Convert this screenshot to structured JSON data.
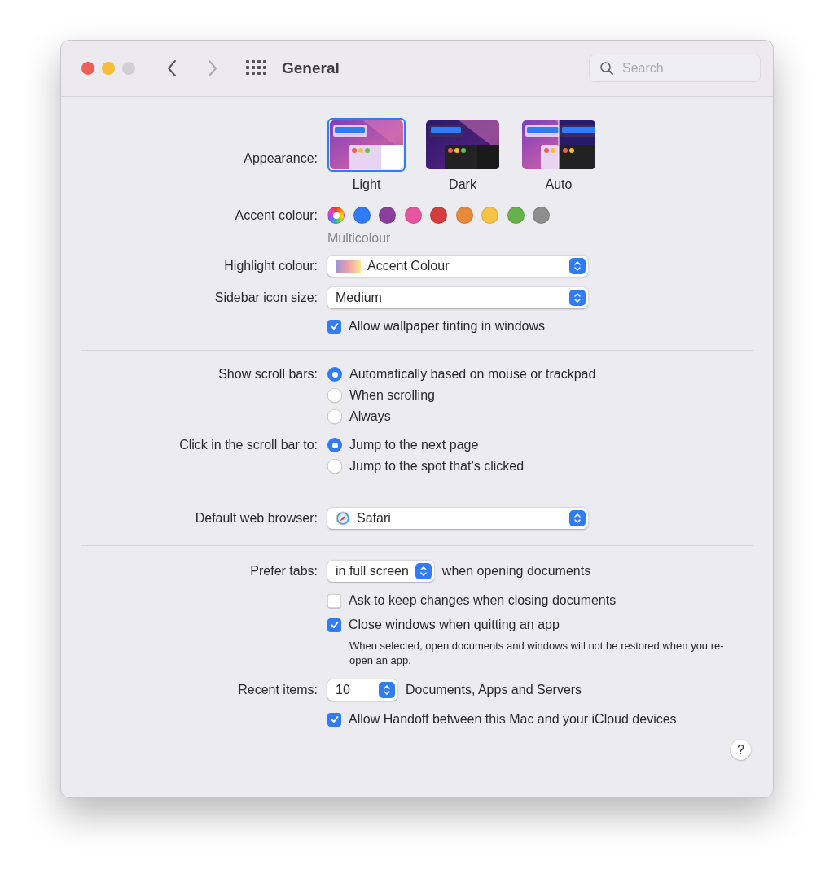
{
  "window": {
    "title": "General",
    "back": {
      "disabled": false
    },
    "forward": {
      "disabled": true
    },
    "search": {
      "placeholder": "Search"
    }
  },
  "sections": [
    {
      "rows": [
        {
          "kind": "appearance",
          "label": "Appearance:",
          "options": [
            {
              "label": "Light",
              "selected": true
            },
            {
              "label": "Dark",
              "selected": false
            },
            {
              "label": "Auto",
              "selected": false
            }
          ]
        },
        {
          "kind": "accent",
          "label": "Accent colour:",
          "caption": "Multicolour",
          "swatches": [
            {
              "kind": "multi",
              "selected": true
            },
            {
              "kind": "solid",
              "color": "#2f7cf6",
              "selected": false
            },
            {
              "kind": "solid",
              "color": "#8a3f9a",
              "selected": false
            },
            {
              "kind": "solid",
              "color": "#e6569e",
              "selected": false
            },
            {
              "kind": "solid",
              "color": "#d33c3c",
              "selected": false
            },
            {
              "kind": "solid",
              "color": "#e98a35",
              "selected": false
            },
            {
              "kind": "solid",
              "color": "#f6c443",
              "selected": false
            },
            {
              "kind": "solid",
              "color": "#68b04a",
              "selected": false
            },
            {
              "kind": "solid",
              "color": "#8e8e8e",
              "selected": false
            }
          ]
        },
        {
          "kind": "popup",
          "label": "Highlight colour:",
          "value": "Accent Colour"
        },
        {
          "kind": "popup",
          "label": "Sidebar icon size:",
          "value": "Medium"
        },
        {
          "kind": "checkbox",
          "text": "Allow wallpaper tinting in windows",
          "checked": true
        }
      ]
    },
    {
      "rows": [
        {
          "kind": "radio",
          "label": "Show scroll bars:",
          "options": [
            {
              "label": "Automatically based on mouse or trackpad",
              "selected": true
            },
            {
              "label": "When scrolling",
              "selected": false
            },
            {
              "label": "Always",
              "selected": false
            }
          ]
        },
        {
          "kind": "radio",
          "label": "Click in the scroll bar to:",
          "options": [
            {
              "label": "Jump to the next page",
              "selected": true
            },
            {
              "label": "Jump to the spot that’s clicked",
              "selected": false
            }
          ]
        }
      ]
    },
    {
      "rows": [
        {
          "kind": "popup",
          "label": "Default web browser:",
          "value": "Safari"
        }
      ]
    },
    {
      "rows": [
        {
          "kind": "inline_popup",
          "label": "Prefer tabs:",
          "value": "in full screen",
          "suffix": "when opening documents"
        },
        {
          "kind": "checkbox",
          "text": "Ask to keep changes when closing documents",
          "checked": false
        },
        {
          "kind": "checkbox",
          "text": "Close windows when quitting an app",
          "checked": true,
          "note": "When selected, open documents and windows will not be restored when you re-open an app."
        },
        {
          "kind": "inline_popup",
          "label": "Recent items:",
          "value": "10",
          "suffix": "Documents, Apps and Servers"
        },
        {
          "kind": "checkbox",
          "text": "Allow Handoff between this Mac and your iCloud devices",
          "checked": true
        }
      ]
    }
  ],
  "help": "?"
}
